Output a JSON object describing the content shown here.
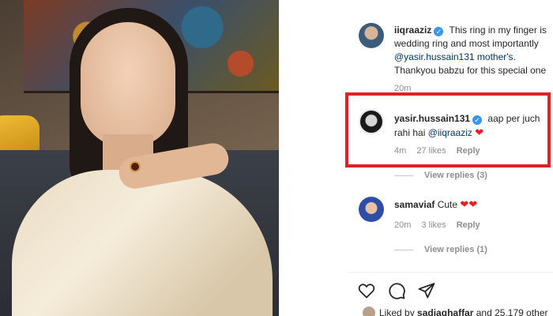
{
  "post": {
    "caption": {
      "username": "iiqraaziz",
      "lines": [
        "This ring in my finger is",
        "wedding ring and most importantly",
        "@yasir.hussain131 mother's.",
        "Thankyou babzu for this special one"
      ],
      "time": "20m"
    }
  },
  "comments": [
    {
      "username": "yasir.hussain131",
      "text_1": "aap per juch",
      "text_2": "rahi hai",
      "mention": "@iiqraaziz",
      "time": "4m",
      "likes": "27 likes",
      "reply": "Reply",
      "view_replies": "View replies (3)",
      "highlighted": true
    },
    {
      "username": "samaviaf",
      "text": "Cute",
      "time": "20m",
      "likes": "3 likes",
      "reply": "Reply",
      "view_replies": "View replies (1)"
    }
  ],
  "footer": {
    "liked_by_prefix": "Liked by",
    "liked_by_user": "sadiaghaffar",
    "liked_by_suffix": "and 25,179 other"
  },
  "icons": [
    "heart-icon",
    "comment-icon",
    "share-icon",
    "verified-icon"
  ],
  "colors": {
    "highlight": "#e31e24",
    "verified": "#3897f0",
    "heart": "#ed1c24"
  }
}
